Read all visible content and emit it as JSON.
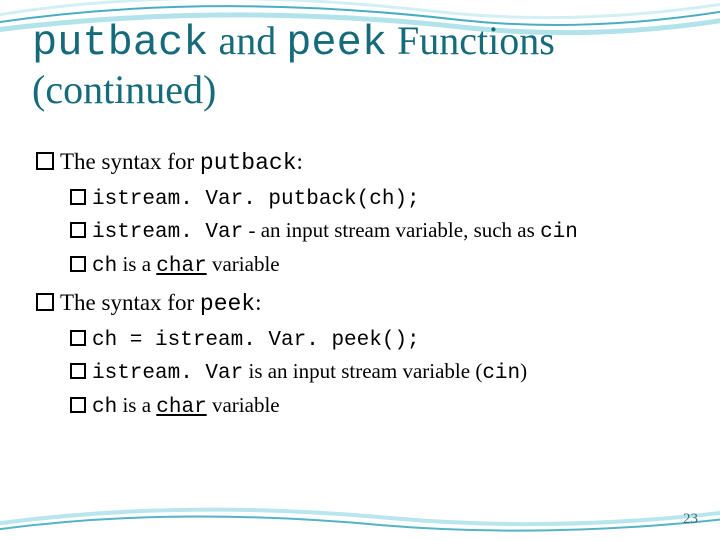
{
  "title": {
    "part1_mono": "putback",
    "part2": " and ",
    "part3_mono": "peek",
    "part4": " Functions (continued)"
  },
  "bullets": {
    "b1_pre": "The syntax for ",
    "b1_mono": "putback",
    "b1_post": ":",
    "b1a_mono": "istream. Var. putback(ch);",
    "b1b_mono1": "istream. Var",
    "b1b_mid": " - an input stream variable, such as ",
    "b1b_mono2": "cin",
    "b1c_mono1": "ch",
    "b1c_mid": " is a ",
    "b1c_mono2_u": "char",
    "b1c_post": " variable",
    "b2_pre": "The syntax for ",
    "b2_mono": "peek",
    "b2_post": ":",
    "b2a_mono": "ch = istream. Var. peek();",
    "b2b_mono1": "istream. Var",
    "b2b_mid": " is an input stream variable (",
    "b2b_mono2": "cin",
    "b2b_post": ")",
    "b2c_mono1": "ch",
    "b2c_mid": " is a ",
    "b2c_mono2_u": "char",
    "b2c_post": " variable"
  },
  "page_number": "23"
}
